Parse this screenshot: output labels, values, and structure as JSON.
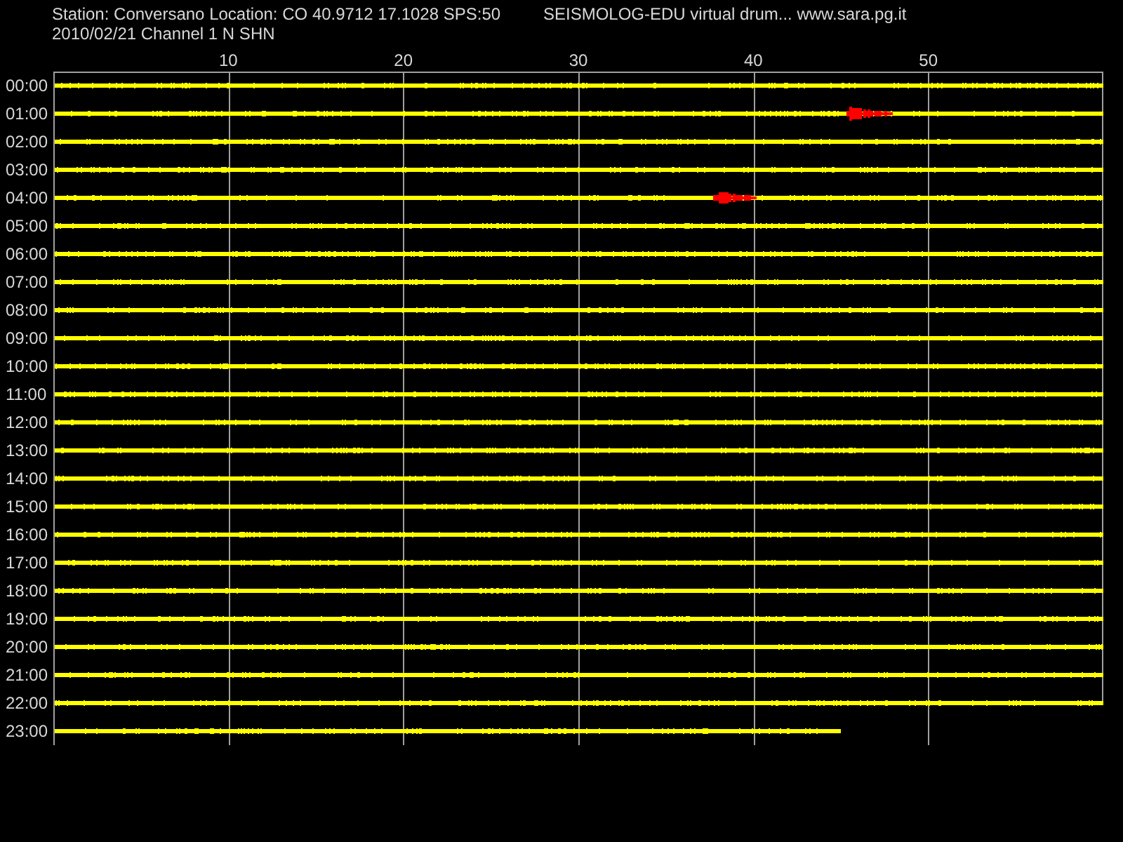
{
  "header": {
    "station": "Station: Conversano Location: CO 40.9712 17.1028 SPS:50",
    "title": "SEISMOLOG-EDU virtual drum... www.sara.pg.it",
    "date_channel": "2010/02/21  Channel 1 N SHN"
  },
  "axis": {
    "ticks": [
      "10",
      "20",
      "30",
      "40",
      "50"
    ]
  },
  "rows": [
    {
      "label": "00:00",
      "level": 1,
      "event": false
    },
    {
      "label": "01:00",
      "level": 1,
      "event": true
    },
    {
      "label": "02:00",
      "level": 1,
      "event": false
    },
    {
      "label": "03:00",
      "level": 1,
      "event": false
    },
    {
      "label": "04:00",
      "level": 1,
      "event": true
    },
    {
      "label": "05:00",
      "level": 1,
      "event": false
    },
    {
      "label": "06:00",
      "level": 1,
      "event": false
    },
    {
      "label": "07:00",
      "level": 1,
      "event": false
    },
    {
      "label": "08:00",
      "level": 1,
      "event": false
    },
    {
      "label": "09:00",
      "level": 1,
      "event": false
    },
    {
      "label": "10:00",
      "level": 1,
      "event": false
    },
    {
      "label": "11:00",
      "level": 1,
      "event": false
    },
    {
      "label": "12:00",
      "level": 1,
      "event": false
    },
    {
      "label": "13:00",
      "level": 1,
      "event": false
    },
    {
      "label": "14:00",
      "level": 1,
      "event": false
    },
    {
      "label": "15:00",
      "level": 1,
      "event": false
    },
    {
      "label": "16:00",
      "level": 1,
      "event": false
    },
    {
      "label": "17:00",
      "level": 1,
      "event": false
    },
    {
      "label": "18:00",
      "level": 1,
      "event": false
    },
    {
      "label": "19:00",
      "level": 1,
      "event": false
    },
    {
      "label": "20:00",
      "level": 1,
      "event": false
    },
    {
      "label": "21:00",
      "level": 1,
      "event": false
    },
    {
      "label": "22:00",
      "level": 1,
      "event": false
    },
    {
      "label": "23:00",
      "level": 0.75,
      "event": false
    }
  ]
}
